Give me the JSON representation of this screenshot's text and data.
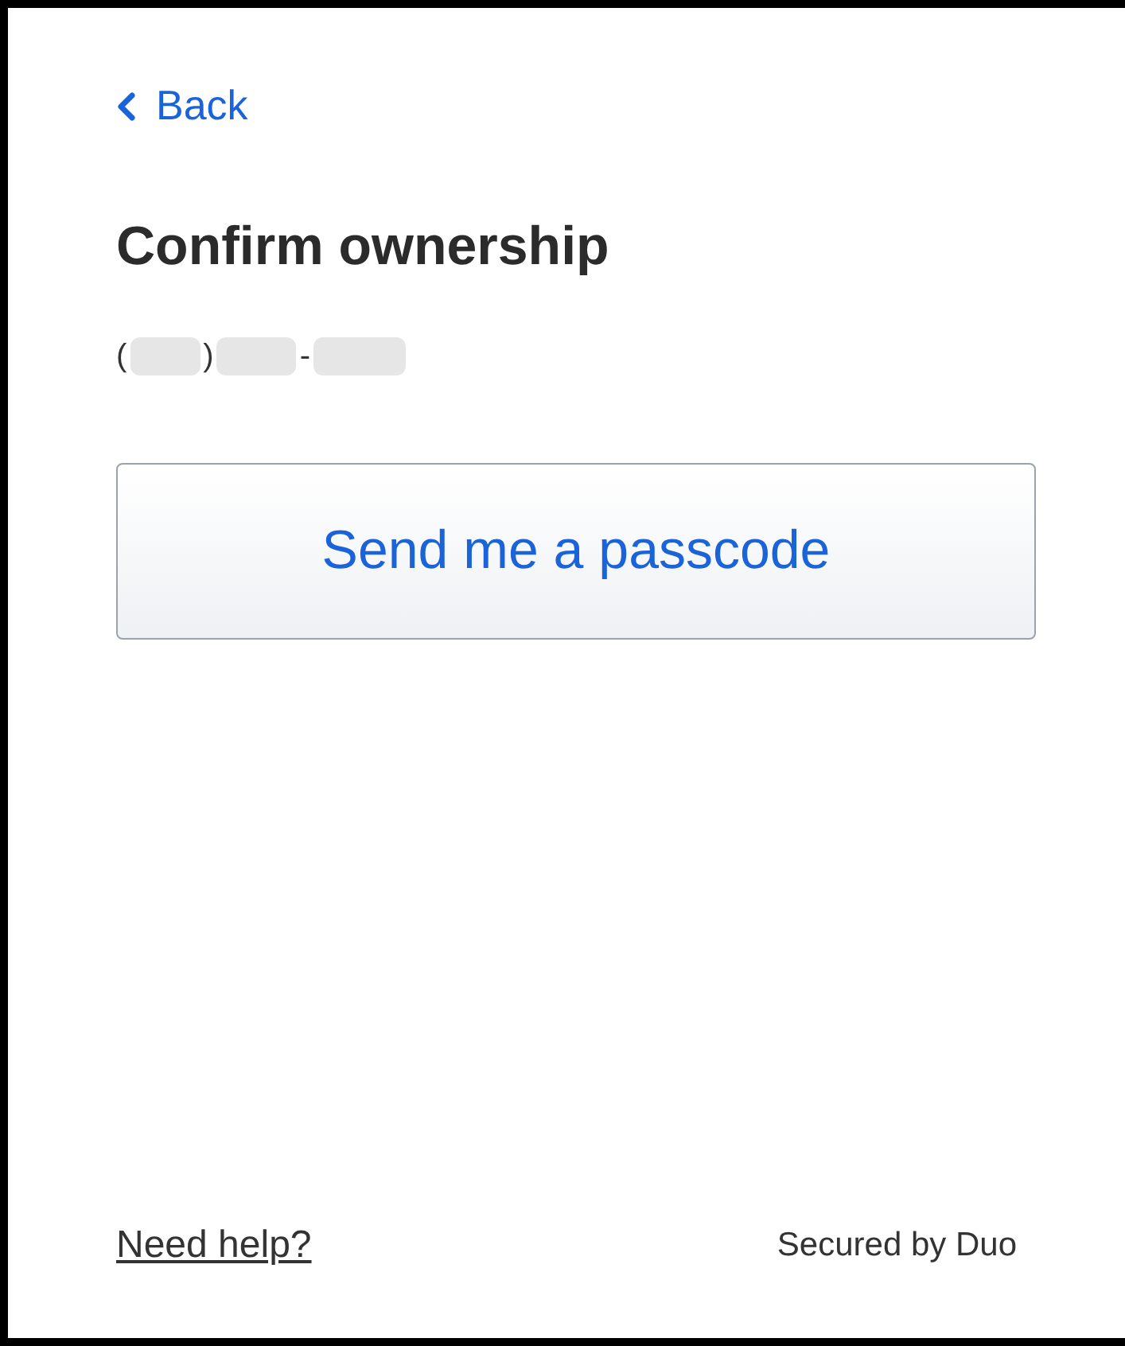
{
  "back_link": {
    "label": "Back"
  },
  "title": "Confirm ownership",
  "phone_number": {
    "visible_parts": [
      "(",
      ")",
      "-"
    ]
  },
  "primary_button": {
    "label": "Send me a passcode"
  },
  "footer": {
    "help_link": "Need help?",
    "secured_by": "Secured by Duo"
  }
}
